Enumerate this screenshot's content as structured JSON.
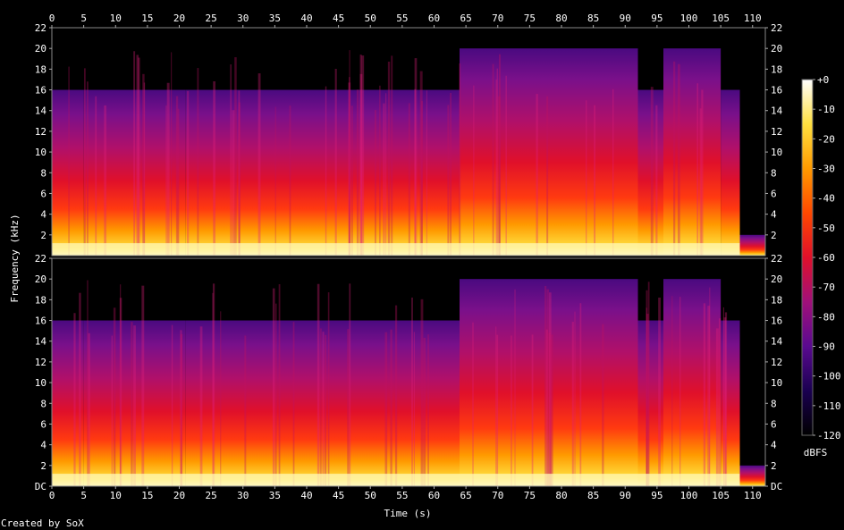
{
  "chart_data": {
    "type": "heatmap",
    "title": "",
    "xlabel": "Time (s)",
    "ylabel": "Frequency (kHz)",
    "xlim": [
      0,
      112
    ],
    "ylim": [
      0,
      22
    ],
    "x_ticks": [
      "0",
      "5",
      "10",
      "15",
      "20",
      "25",
      "30",
      "35",
      "40",
      "45",
      "50",
      "55",
      "60",
      "65",
      "70",
      "75",
      "80",
      "85",
      "90",
      "95",
      "100",
      "105",
      "110"
    ],
    "y_ticks": [
      "DC",
      "2",
      "4",
      "6",
      "8",
      "10",
      "12",
      "14",
      "16",
      "18",
      "20",
      "22"
    ],
    "channels": 2,
    "colorbar": {
      "label": "dBFS",
      "range": [
        -120,
        0
      ],
      "ticks": [
        "+0",
        "-10",
        "-20",
        "-30",
        "-40",
        "-50",
        "-60",
        "-70",
        "-80",
        "-90",
        "-100",
        "-110",
        "-120"
      ],
      "colors": [
        "#000000",
        "#1a0050",
        "#5a0a90",
        "#a0107a",
        "#e0102a",
        "#ff4800",
        "#ff9a00",
        "#ffe040",
        "#ffffff"
      ]
    },
    "regions": [
      {
        "t": [
          0,
          5
        ],
        "cutoff_khz": 16
      },
      {
        "t": [
          5,
          21
        ],
        "cutoff_khz": 16
      },
      {
        "t": [
          21,
          64
        ],
        "cutoff_khz": 16
      },
      {
        "t": [
          64,
          92
        ],
        "cutoff_khz": 20
      },
      {
        "t": [
          92,
          96
        ],
        "cutoff_khz": 16
      },
      {
        "t": [
          96,
          105
        ],
        "cutoff_khz": 20
      },
      {
        "t": [
          105,
          108
        ],
        "cutoff_khz": 16
      },
      {
        "t": [
          108,
          112
        ],
        "cutoff_khz": 2
      }
    ]
  },
  "footer": {
    "credit": "Created by SoX"
  }
}
